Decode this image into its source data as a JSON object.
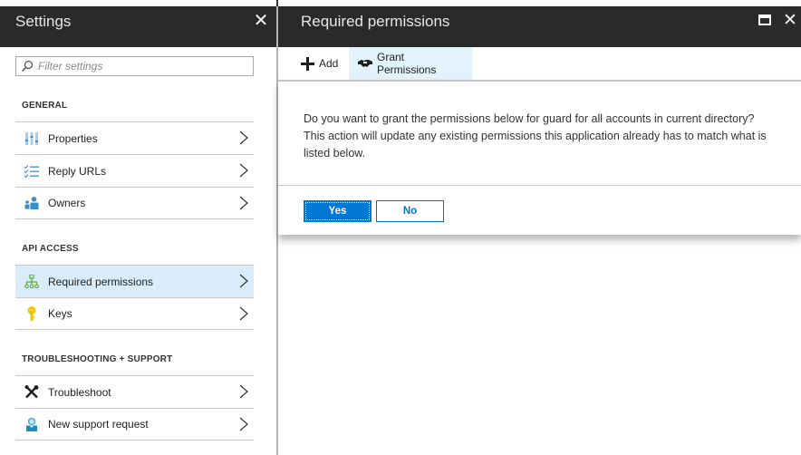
{
  "settings_blade": {
    "title": "Settings",
    "close_icon": "close-icon",
    "filter": {
      "placeholder": "Filter settings",
      "value": "",
      "icon": "search-icon"
    },
    "sections": [
      {
        "title": "GENERAL",
        "items": [
          {
            "label": "Properties",
            "icon": "properties-sliders-icon",
            "selected": false
          },
          {
            "label": "Reply URLs",
            "icon": "checklist-icon",
            "selected": false
          },
          {
            "label": "Owners",
            "icon": "owners-users-icon",
            "selected": false
          }
        ]
      },
      {
        "title": "API ACCESS",
        "items": [
          {
            "label": "Required permissions",
            "icon": "hierarchy-icon",
            "selected": true
          },
          {
            "label": "Keys",
            "icon": "key-icon",
            "selected": false
          }
        ]
      },
      {
        "title": "TROUBLESHOOTING + SUPPORT",
        "items": [
          {
            "label": "Troubleshoot",
            "icon": "wrench-screwdriver-icon",
            "selected": false
          },
          {
            "label": "New support request",
            "icon": "support-person-icon",
            "selected": false
          }
        ]
      }
    ]
  },
  "permissions_blade": {
    "title": "Required permissions",
    "maximize_icon": "maximize-icon",
    "close_icon": "close-icon",
    "toolbar": {
      "add_label": "Add",
      "grant_label": "Grant Permissions"
    },
    "dialog": {
      "message": "Do you want to grant the permissions below for guard for all accounts in current directory? This action will update any existing permissions this application already has to match what is listed below.",
      "yes_label": "Yes",
      "no_label": "No"
    }
  },
  "colors": {
    "header_bg": "#2a2a2a",
    "accent": "#0078d4",
    "selected_item_bg": "#d9ecf9",
    "toolbar_active_bg": "#e3f3fb"
  }
}
